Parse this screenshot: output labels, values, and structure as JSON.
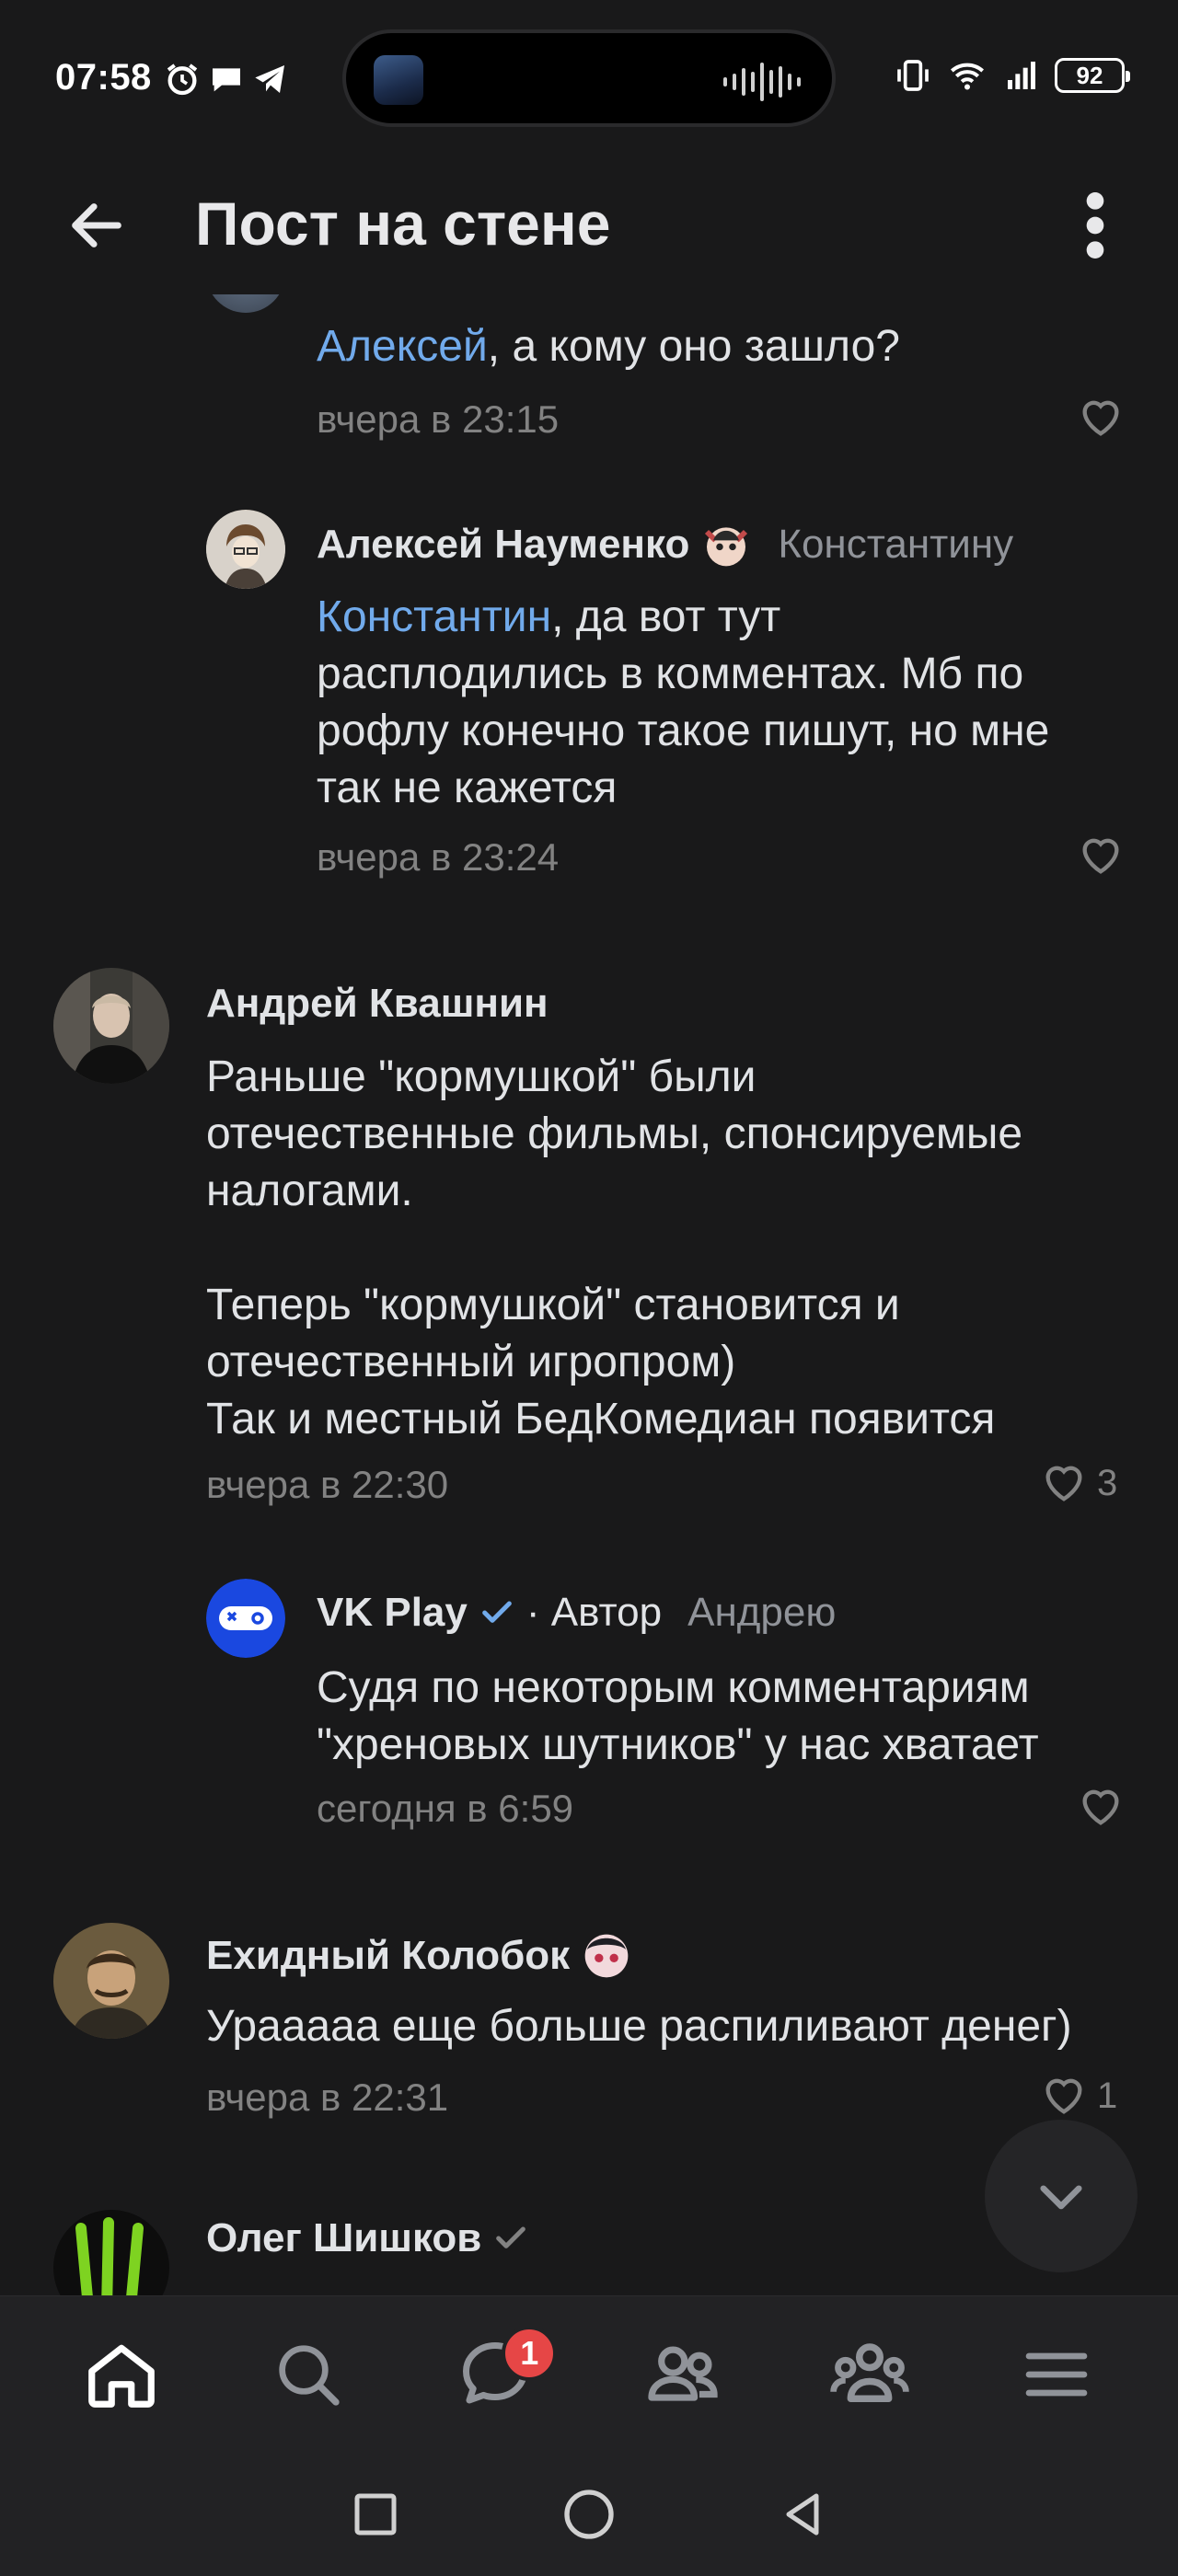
{
  "status_bar": {
    "time": "07:58",
    "battery": "92"
  },
  "header": {
    "title": "Пост на стене"
  },
  "comments": [
    {
      "mention": "Алексей",
      "text": ", а кому оно зашло?",
      "time": "вчера в 23:15"
    },
    {
      "author": "Алексей Науменко",
      "reply_to": "Константину",
      "mention": "Константин",
      "text": ", да вот тут\nрасплодились в комментах. Мб по\nрофлу конечно такое пишут, но мне\nтак не кажется",
      "time": "вчера в 23:24"
    },
    {
      "author": "Андрей Квашнин",
      "text": "Раньше \"кормушкой\" были\nотечественные фильмы, спонсируемые\nналогами.\n\nТеперь \"кормушкой\" становится и\nотечественный игропром)\nТак и местный БедКомедиан появится",
      "time": "вчера в 22:30",
      "likes": "3"
    },
    {
      "author": "VK Play",
      "author_tag": "· Автор",
      "reply_to": "Андрею",
      "text": "Судя по некоторым комментариям\n\"хреновых шутников\" у нас хватает",
      "time": "сегодня в 6:59"
    },
    {
      "author": "Ехидный Колобок",
      "text": "Урааааа еще больше распиливают денег)",
      "time": "вчера в 22:31",
      "likes": "1"
    },
    {
      "author": "Олег Шишков"
    }
  ],
  "bottom_nav": {
    "messages_badge": "1"
  },
  "colors": {
    "background": "#19191a",
    "accent": "#71aaeb",
    "badge": "#e64646",
    "secondary_text": "#828282"
  }
}
